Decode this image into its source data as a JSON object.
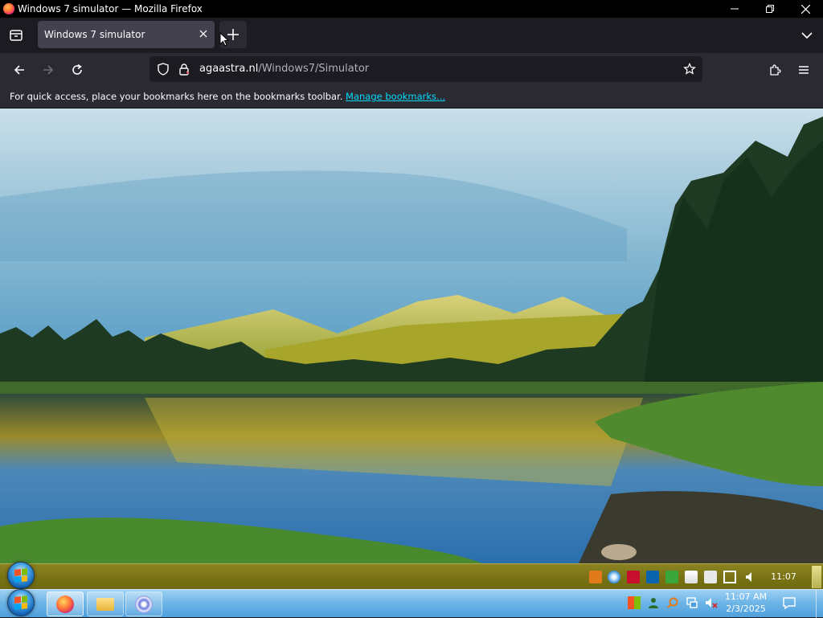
{
  "window": {
    "title": "Windows 7 simulator — Mozilla Firefox"
  },
  "tabs": [
    {
      "label": "Windows 7 simulator",
      "active": true
    }
  ],
  "urlbar": {
    "domain": "agaastra.nl",
    "path": "/Windows7/Simulator"
  },
  "bookmarks_toolbar": {
    "message": "For quick access, place your bookmarks here on the bookmarks toolbar. ",
    "link": "Manage bookmarks..."
  },
  "inner_taskbar": {
    "clock": "11:07",
    "tray_icons": [
      "zip-icon",
      "globe-icon",
      "pdf-icon",
      "outlook-icon",
      "check-shield-icon",
      "flag-x-icon",
      "clipboard-icon",
      "network-icon",
      "volume-icon"
    ]
  },
  "outer_taskbar": {
    "pinned": [
      "firefox-icon",
      "file-explorer-icon",
      "app-icon"
    ],
    "clock_time": "11:07 AM",
    "clock_date": "2/3/2025",
    "tray_icons": [
      "action-center-flag-icon",
      "people-icon",
      "search-icon",
      "network-icon",
      "volume-muted-icon"
    ]
  },
  "colors": {
    "accent_link": "#00ddff",
    "tab_active_bg": "#42414d",
    "toolbar_bg": "#2b2a33"
  }
}
